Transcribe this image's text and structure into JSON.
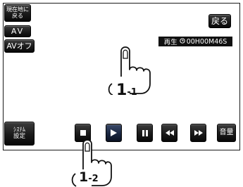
{
  "buttons": {
    "current_location_line1": "現在地に",
    "current_location_line2": "戻る",
    "av": "AV",
    "av_off": "AVオフ",
    "back": "戻る",
    "system_line1": "ｼｽﾃﾑ",
    "system_line2": "設定",
    "volume": "音量"
  },
  "status": {
    "label": "再生",
    "icon": "clock-icon",
    "time": "00H00M46S"
  },
  "controls": [
    "stop-icon",
    "play-icon",
    "pause-icon",
    "rewind-icon",
    "fast-forward-icon"
  ],
  "callouts": {
    "c1_main": "1",
    "c1_sub": "-1",
    "c2_main": "1",
    "c2_sub": "-2"
  }
}
